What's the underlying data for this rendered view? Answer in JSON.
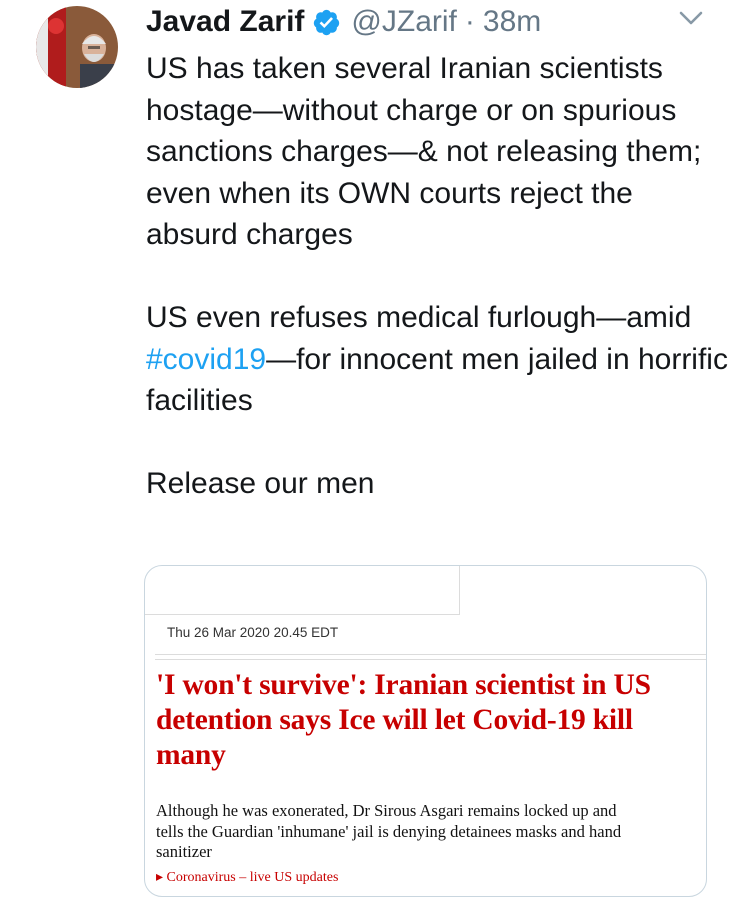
{
  "tweet": {
    "display_name": "Javad Zarif",
    "handle": "@JZarif",
    "separator": "·",
    "time": "38m",
    "verified_icon": "verified-badge-icon",
    "menu_icon": "chevron-down-icon",
    "avatar_icon": "profile-avatar",
    "text_para1": "US has taken several Iranian scientists hostage—without charge or on spurious sanctions charges—& not releasing them; even when its OWN courts reject the absurd charges",
    "text_para2_before": "US even refuses medical furlough—amid ",
    "hashtag": "#covid19",
    "text_para2_after": "—for innocent men jailed in horrific facilities",
    "text_para3": "Release our men"
  },
  "card": {
    "date": "Thu 26 Mar 2020 20.45 EDT",
    "headline": "'I won't survive': Iranian scientist in US detention says Ice will let Covid-19 kill many",
    "standfirst": "Although he was exonerated, Dr Sirous Asgari remains locked up and tells the Guardian 'inhumane' jail is denying detainees masks and hand sanitizer",
    "related_partial": "▸ Coronavirus – live US updates"
  },
  "colors": {
    "text": "#14171a",
    "secondary": "#657786",
    "link": "#1da1f2",
    "verified": "#1da1f2",
    "headline_red": "#c70000",
    "card_border": "#c9d6df"
  }
}
